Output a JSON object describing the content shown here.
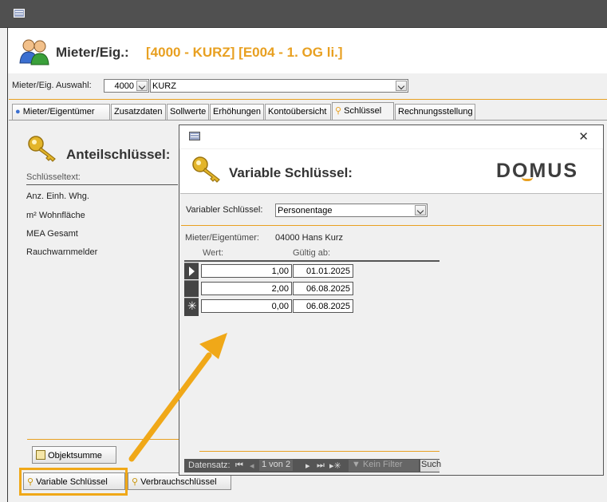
{
  "header": {
    "title": "Mieter/Eig.:",
    "subtitle": "[4000 - KURZ] [E004 - 1. OG li.]"
  },
  "selection": {
    "label": "Mieter/Eig. Auswahl:",
    "number": "4000",
    "name": "KURZ"
  },
  "tabs": [
    {
      "label": "Mieter/Eigentümer"
    },
    {
      "label": "Zusatzdaten"
    },
    {
      "label": "Sollwerte"
    },
    {
      "label": "Erhöhungen"
    },
    {
      "label": "Kontoübersicht"
    },
    {
      "label": "Schlüssel"
    },
    {
      "label": "Rechnungsstellung"
    }
  ],
  "anteil": {
    "title": "Anteilschlüssel:",
    "col_header": "Schlüsseltext:",
    "rows": [
      "Anz. Einh. Whg.",
      "m² Wohnfläche",
      "MEA Gesamt",
      "Rauchwarnmelder"
    ]
  },
  "buttons": {
    "objektsumme": "Objektsumme",
    "variable": "Variable Schlüssel",
    "verbrauch": "Verbrauchschlüssel"
  },
  "popup": {
    "title": "Variable Schlüssel:",
    "logo": "DOMUS",
    "close": "✕",
    "key_label": "Variabler Schlüssel:",
    "key_value": "Personentage",
    "owner_label": "Mieter/Eigentümer:",
    "owner_value": "04000  Hans Kurz",
    "col_wert": "Wert:",
    "col_gueltig": "Gültig ab:",
    "rows": [
      {
        "wert": "1,00",
        "gueltig": "01.01.2025"
      },
      {
        "wert": "2,00",
        "gueltig": "06.08.2025"
      },
      {
        "wert": "0,00",
        "gueltig": "06.08.2025"
      }
    ],
    "nav": {
      "label": "Datensatz:",
      "position": "1 von 2",
      "filter": "Kein Filter",
      "search": "Such"
    }
  },
  "colors": {
    "accent": "#e8a021",
    "highlight": "#f0a818"
  }
}
